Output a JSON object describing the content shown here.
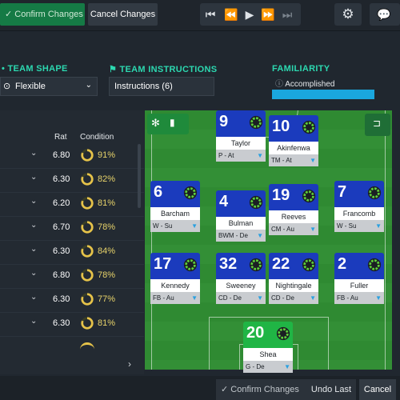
{
  "toolbar": {
    "confirm_label": "Confirm Changes",
    "cancel_label": "Cancel Changes"
  },
  "team_shape": {
    "title": "TEAM SHAPE",
    "value": "Flexible"
  },
  "team_instructions": {
    "title": "TEAM INSTRUCTIONS",
    "value": "Instructions (6)"
  },
  "familiarity": {
    "title": "FAMILIARITY",
    "value": "Accomplished"
  },
  "table": {
    "col_rat": "Rat",
    "col_condition": "Condition",
    "rows": [
      {
        "rat": "6.80",
        "condition": "91%"
      },
      {
        "rat": "6.30",
        "condition": "82%"
      },
      {
        "rat": "6.20",
        "condition": "81%"
      },
      {
        "rat": "6.70",
        "condition": "78%"
      },
      {
        "rat": "6.30",
        "condition": "84%"
      },
      {
        "rat": "6.80",
        "condition": "78%"
      },
      {
        "rat": "6.30",
        "condition": "77%"
      },
      {
        "rat": "6.30",
        "condition": "81%"
      }
    ]
  },
  "players": [
    {
      "num": "9",
      "name": "Taylor",
      "role": "P - At"
    },
    {
      "num": "10",
      "name": "Akinfenwa",
      "role": "TM - At"
    },
    {
      "num": "6",
      "name": "Barcham",
      "role": "W - Su"
    },
    {
      "num": "4",
      "name": "Bulman",
      "role": "BWM - De"
    },
    {
      "num": "19",
      "name": "Reeves",
      "role": "CM - Au"
    },
    {
      "num": "7",
      "name": "Francomb",
      "role": "W - Su"
    },
    {
      "num": "17",
      "name": "Kennedy",
      "role": "FB - Au"
    },
    {
      "num": "32",
      "name": "Sweeney",
      "role": "CD - De"
    },
    {
      "num": "22",
      "name": "Nightingale",
      "role": "CD - De"
    },
    {
      "num": "2",
      "name": "Fuller",
      "role": "FB - Au"
    },
    {
      "num": "20",
      "name": "Shea",
      "role": "G - De"
    }
  ],
  "bottom": {
    "confirm_label": "Confirm Changes",
    "undo_label": "Undo Last",
    "cancel_label": "Cancel"
  },
  "colors": {
    "accent": "#2cd8b0",
    "confirm": "#157a45",
    "outfield": "#1b3bbd",
    "keeper": "#20b545",
    "pitch": "#2f8a32"
  }
}
